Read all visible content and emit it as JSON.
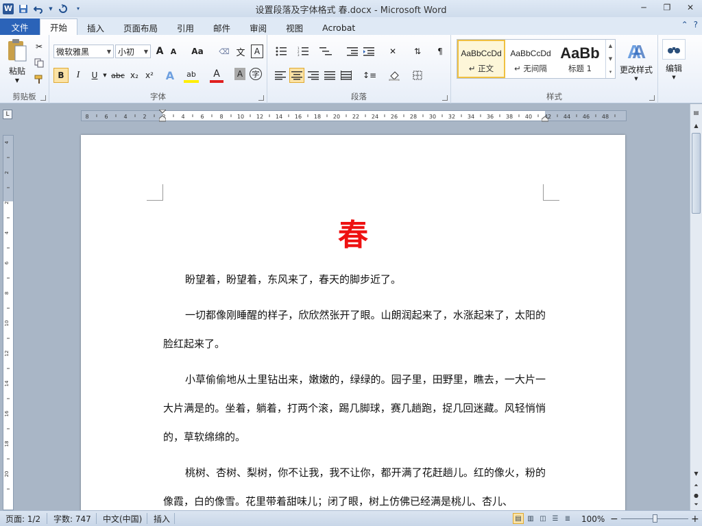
{
  "window": {
    "title": "设置段落及字体格式 春.docx - Microsoft Word",
    "controls": [
      "─",
      "❐",
      "✕"
    ]
  },
  "quick_access": {
    "logo": "W",
    "save_icon": "save-icon",
    "undo_icon": "undo-icon",
    "redo_icon": "redo-icon"
  },
  "tabs": [
    {
      "label": "文件"
    },
    {
      "label": "开始"
    },
    {
      "label": "插入"
    },
    {
      "label": "页面布局"
    },
    {
      "label": "引用"
    },
    {
      "label": "邮件"
    },
    {
      "label": "审阅"
    },
    {
      "label": "视图"
    },
    {
      "label": "Acrobat"
    }
  ],
  "ribbon": {
    "clipboard": {
      "label": "剪贴板",
      "paste": "粘贴"
    },
    "font": {
      "label": "字体",
      "font_name": "微软雅黑",
      "font_size": "小初",
      "grow": "A",
      "shrink": "A",
      "case": "Aa",
      "bold": "B",
      "italic": "I",
      "underline": "U",
      "strike": "abc",
      "subscript": "x₂",
      "superscript": "x²",
      "highlight": "ab",
      "font_color": "A",
      "char_shade": "A",
      "enclose": "字",
      "phonetic": "文",
      "border": "A"
    },
    "paragraph": {
      "label": "段落"
    },
    "styles": {
      "label": "样式",
      "items": [
        {
          "preview": "AaBbCcDd",
          "name": "↵ 正文"
        },
        {
          "preview": "AaBbCcDd",
          "name": "↵ 无间隔"
        },
        {
          "preview": "AaBb",
          "name": "标题 1"
        }
      ],
      "change": "更改样式"
    },
    "editing": {
      "label": "编辑"
    }
  },
  "ruler": {
    "ticks": [
      "8",
      "6",
      "4",
      "2",
      "2",
      "4",
      "6",
      "8",
      "10",
      "12",
      "14",
      "16",
      "18",
      "20",
      "22",
      "24",
      "26",
      "28",
      "30",
      "32",
      "34",
      "36",
      "38",
      "40",
      "42",
      "44",
      "46",
      "48"
    ],
    "vticks": [
      "4",
      "2",
      "2",
      "4",
      "6",
      "8",
      "10",
      "12",
      "14",
      "16",
      "18",
      "20"
    ]
  },
  "document": {
    "title": "春",
    "paragraphs": [
      "盼望着，盼望着，东风来了，春天的脚步近了。",
      "一切都像刚睡醒的样子，欣欣然张开了眼。山朗润起来了，水涨起来了，太阳的脸红起来了。",
      "小草偷偷地从土里钻出来，嫩嫩的，绿绿的。园子里，田野里，瞧去，一大片一大片满是的。坐着，躺着，打两个滚，踢几脚球，赛几趟跑，捉几回迷藏。风轻悄悄的，草软绵绵的。",
      "桃树、杏树、梨树，你不让我，我不让你，都开满了花赶趟儿。红的像火，粉的像霞，白的像雪。花里带着甜味儿；闭了眼，树上仿佛已经满是桃儿、杏儿、"
    ]
  },
  "statusbar": {
    "page": "页面: 1/2",
    "words": "字数: 747",
    "language": "中文(中国)",
    "mode": "插入",
    "zoom": "100%",
    "zoom_minus": "−",
    "zoom_plus": "+"
  },
  "colors": {
    "title_red": "#ee1111",
    "file_tab": "#2b63b8",
    "accent_border": "#f0c040"
  }
}
